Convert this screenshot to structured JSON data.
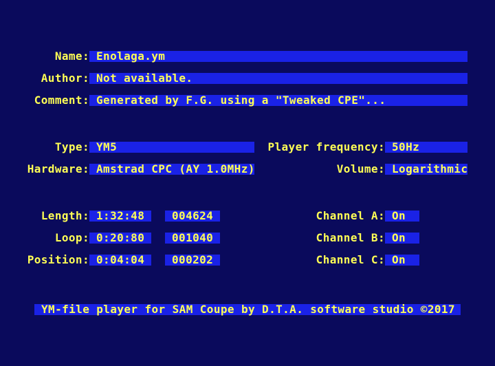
{
  "info": {
    "name_label": "Name:",
    "name_value": "Enolaga.ym",
    "author_label": "Author:",
    "author_value": "Not available.",
    "comment_label": "Comment:",
    "comment_value": "Generated by F.G. using a \"Tweaked CPE\"..."
  },
  "format": {
    "type_label": "Type:",
    "type_value": "YM5",
    "hardware_label": "Hardware:",
    "hardware_value": "Amstrad CPC (AY 1.0MHz)",
    "frequency_label": "Player frequency:",
    "frequency_value": "50Hz",
    "volume_label": "Volume:",
    "volume_value": "Logarithmic"
  },
  "timing": {
    "length_label": "Length:",
    "length_time": "1:32:48",
    "length_frames": "004624",
    "loop_label": "Loop:",
    "loop_time": "0:20:80",
    "loop_frames": "001040",
    "position_label": "Position:",
    "position_time": "0:04:04",
    "position_frames": "000202"
  },
  "channels": {
    "a_label": "Channel A:",
    "a_value": "On",
    "b_label": "Channel B:",
    "b_value": "On",
    "c_label": "Channel C:",
    "c_value": "On"
  },
  "footer": {
    "text": "YM-file player for SAM Coupe by D.T.A. software studio ©2017"
  },
  "colors": {
    "background": "#0a0a5c",
    "field": "#1a22e6",
    "text": "#ffff55"
  }
}
